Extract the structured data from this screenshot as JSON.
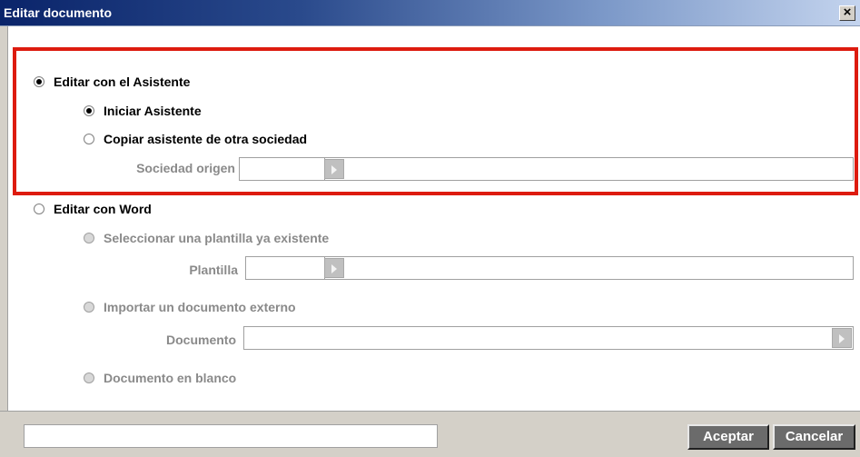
{
  "window": {
    "title": "Editar documento",
    "close_label": "×"
  },
  "options": {
    "edit_wizard": {
      "label": "Editar con el Asistente",
      "checked": true
    },
    "start_wizard": {
      "label": "Iniciar Asistente",
      "checked": true
    },
    "copy_wizard": {
      "label": "Copiar asistente de otra sociedad",
      "checked": false
    },
    "source_company": {
      "label": "Sociedad origen",
      "code": "",
      "name": ""
    },
    "edit_word": {
      "label": "Editar con Word",
      "checked": false
    },
    "select_template": {
      "label": "Seleccionar una plantilla ya existente",
      "enabled": false
    },
    "template": {
      "label": "Plantilla",
      "code": "",
      "name": ""
    },
    "import_document": {
      "label": "Importar un documento externo",
      "enabled": false
    },
    "document": {
      "label": "Documento",
      "value": ""
    },
    "blank_document": {
      "label": "Documento en blanco",
      "enabled": false
    }
  },
  "footer": {
    "status_text": "",
    "accept_label": "Aceptar",
    "cancel_label": "Cancelar"
  },
  "colors": {
    "highlight": "#dd1b0f",
    "title_start": "#0a246a",
    "title_end": "#c4d4ee",
    "button_bg": "#6b6b6b"
  }
}
